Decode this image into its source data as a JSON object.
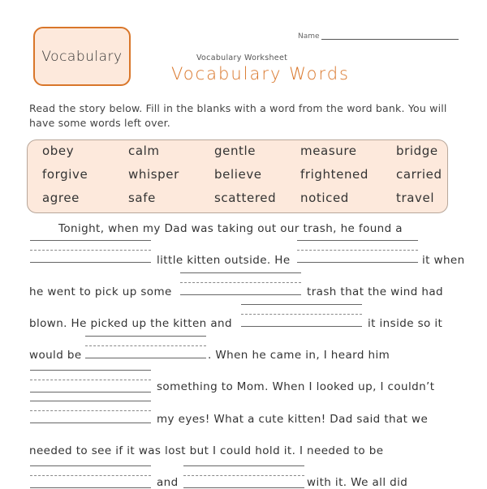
{
  "header": {
    "badge_label": "Vocabulary",
    "name_label": "Name",
    "subtitle": "Vocabulary Worksheet",
    "title": "Vocabulary Words"
  },
  "instructions": "Read the story below.  Fill in the blanks with a word from the word bank.  You will have some words left over.",
  "word_bank": {
    "rows": [
      [
        "obey",
        "calm",
        "gentle",
        "measure",
        "bridge"
      ],
      [
        "forgive",
        "whisper",
        "believe",
        "frightened",
        "carried"
      ],
      [
        "agree",
        "safe",
        "scattered",
        "noticed",
        "travel"
      ]
    ]
  },
  "story": {
    "lines": [
      "Tonight, when my Dad was taking out our trash, he found a",
      "little kitten outside.  He",
      "it when",
      "he went to pick up some",
      "trash that the wind had",
      "blown.  He picked up the kitten and",
      "it inside so it",
      "would be",
      ".  When he came in, I heard him",
      "something to Mom.  When I looked up, I couldn’t",
      "my eyes!  What a cute kitten!  Dad said that we",
      "needed to see if it was lost but I could hold it.   I needed to be",
      "and",
      "with it.  We all did"
    ]
  },
  "colors": {
    "accent": "#d9762a",
    "bank_fill": "#fde9dc"
  }
}
